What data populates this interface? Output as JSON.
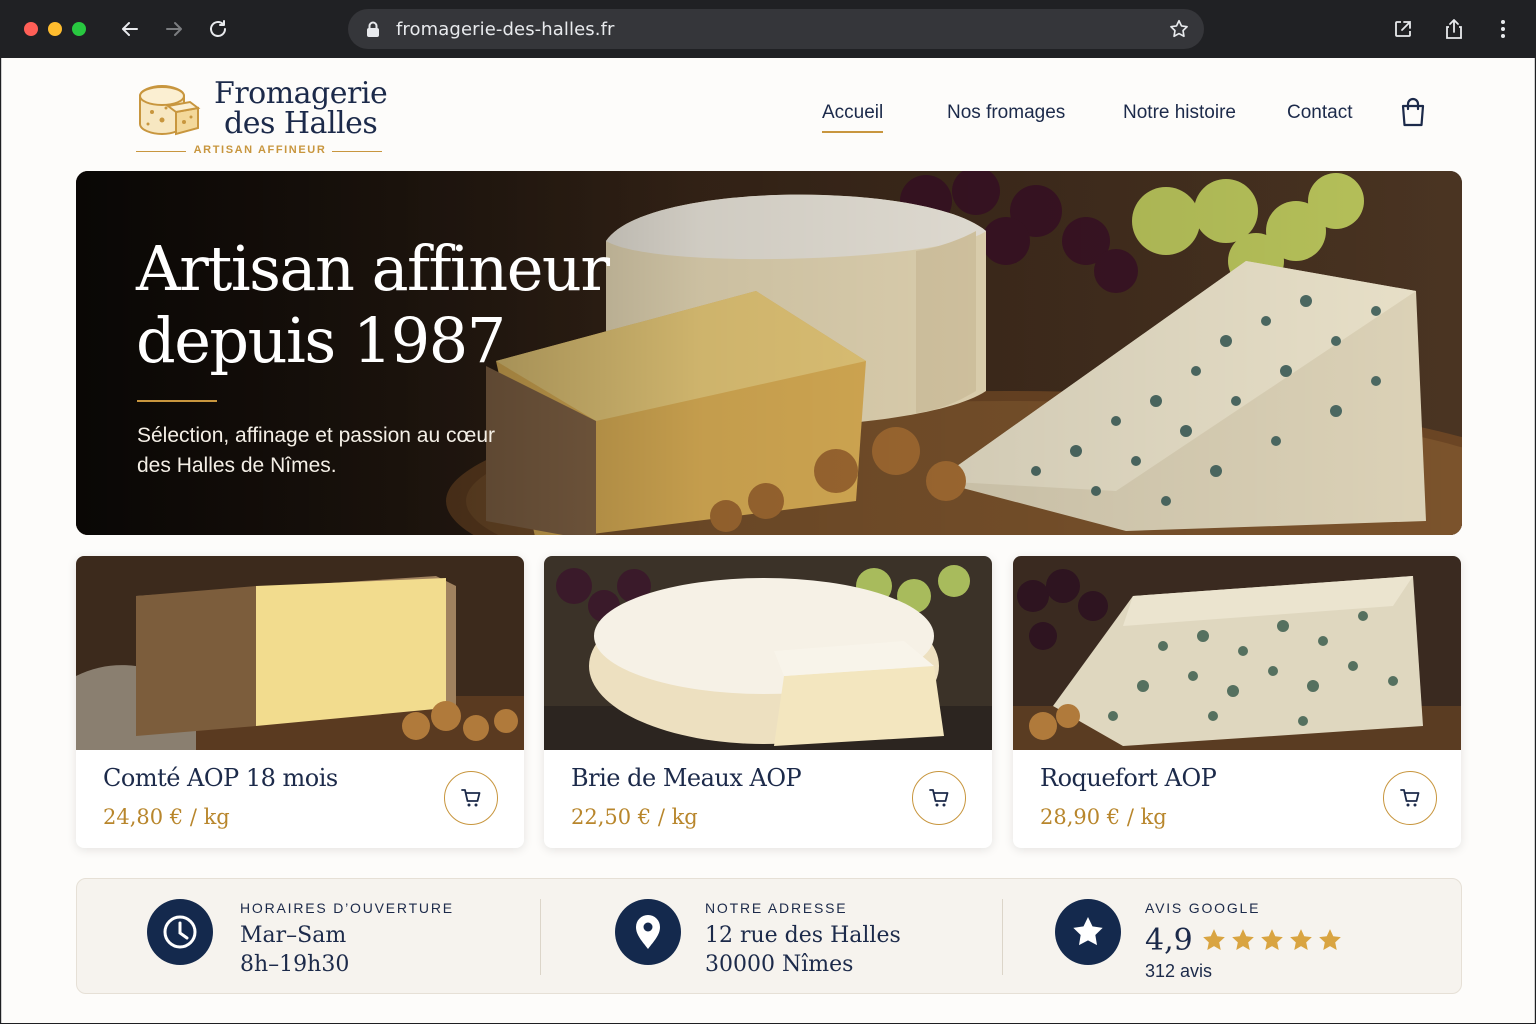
{
  "browser": {
    "url": "fromagerie-des-halles.fr"
  },
  "header": {
    "logo_line1": "Fromagerie",
    "logo_line2": "des Halles",
    "logo_tagline": "ARTISAN AFFINEUR",
    "nav": [
      "Accueil",
      "Nos fromages",
      "Notre histoire",
      "Contact"
    ],
    "active_nav": "Accueil"
  },
  "hero": {
    "title": "Artisan affineur depuis 1987",
    "subtitle": "Sélection, affinage et passion au cœur des Halles de Nîmes."
  },
  "products": [
    {
      "name": "Comté AOP 18 mois",
      "price": "24,80 € / kg"
    },
    {
      "name": "Brie de Meaux AOP",
      "price": "22,50 € / kg"
    },
    {
      "name": "Roquefort AOP",
      "price": "28,90 € / kg"
    }
  ],
  "info": {
    "hours_label": "HORAIRES D’OUVERTURE",
    "hours_line1": "Mar–Sam",
    "hours_line2": "8h–19h30",
    "address_label": "NOTRE ADRESSE",
    "address_line1": "12 rue des Halles",
    "address_line2": "30000 Nîmes",
    "reviews_label": "AVIS GOOGLE",
    "rating": "4,9",
    "stars": 5,
    "review_count": "312 avis"
  },
  "colors": {
    "navy": "#14294d",
    "gold": "#c8963e",
    "cream": "#f6f3ee"
  },
  "icons": [
    "back-arrow-icon",
    "forward-arrow-icon",
    "reload-icon",
    "lock-icon",
    "bookmark-star-icon",
    "open-external-icon",
    "share-icon",
    "more-menu-icon",
    "shopping-bag-icon",
    "cart-icon",
    "clock-icon",
    "location-pin-icon",
    "star-icon"
  ]
}
